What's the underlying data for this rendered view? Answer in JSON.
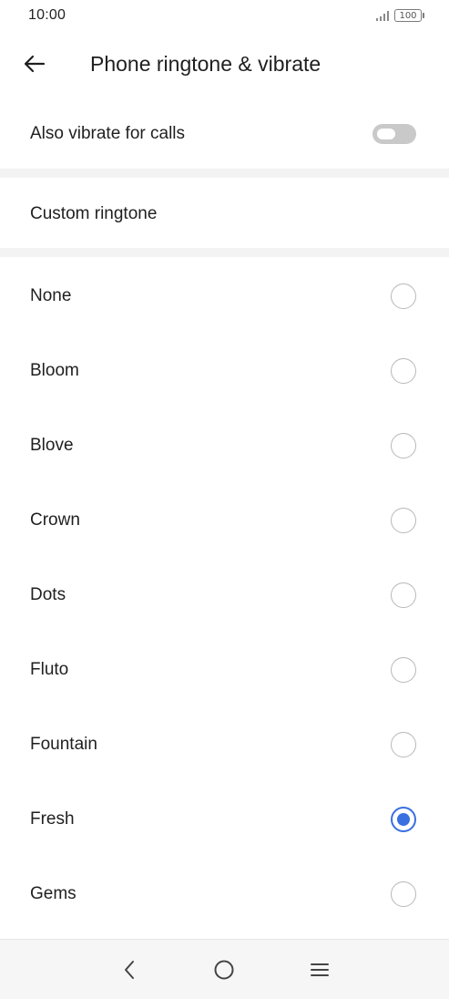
{
  "status_bar": {
    "time": "10:00",
    "battery": "100"
  },
  "header": {
    "back_icon": "arrow-left-icon",
    "title": "Phone ringtone & vibrate"
  },
  "vibrate": {
    "label": "Also vibrate for calls",
    "enabled": false
  },
  "custom_ringtone": {
    "label": "Custom ringtone"
  },
  "ringtones": [
    {
      "label": "None",
      "selected": false
    },
    {
      "label": "Bloom",
      "selected": false
    },
    {
      "label": "Blove",
      "selected": false
    },
    {
      "label": "Crown",
      "selected": false
    },
    {
      "label": "Dots",
      "selected": false
    },
    {
      "label": "Fluto",
      "selected": false
    },
    {
      "label": "Fountain",
      "selected": false
    },
    {
      "label": "Fresh",
      "selected": true
    },
    {
      "label": "Gems",
      "selected": false
    }
  ],
  "colors": {
    "accent": "#3a6fe0",
    "toggle_off": "#c9c9c9",
    "section_band": "#f3f3f3"
  },
  "nav": {
    "back_icon": "chevron-left-icon",
    "home_icon": "circle-home-icon",
    "menu_icon": "hamburger-menu-icon"
  }
}
